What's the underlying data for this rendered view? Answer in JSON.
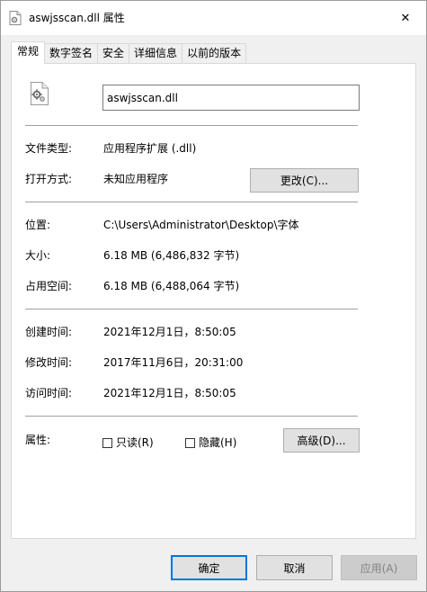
{
  "window": {
    "title": "aswjsscan.dll 属性",
    "close_glyph": "✕"
  },
  "tabs": [
    {
      "label": "常规",
      "active": true
    },
    {
      "label": "数字签名",
      "active": false
    },
    {
      "label": "安全",
      "active": false
    },
    {
      "label": "详细信息",
      "active": false
    },
    {
      "label": "以前的版本",
      "active": false
    }
  ],
  "general": {
    "filename": "aswjsscan.dll",
    "file_type_label": "文件类型:",
    "file_type_value": "应用程序扩展 (.dll)",
    "open_with_label": "打开方式:",
    "open_with_value": "未知应用程序",
    "change_button": "更改(C)...",
    "location_label": "位置:",
    "location_value": "C:\\Users\\Administrator\\Desktop\\字体",
    "size_label": "大小:",
    "size_value": "6.18 MB (6,486,832 字节)",
    "size_on_disk_label": "占用空间:",
    "size_on_disk_value": "6.18 MB (6,488,064 字节)",
    "created_label": "创建时间:",
    "created_value": "2021年12月1日，8:50:05",
    "modified_label": "修改时间:",
    "modified_value": "2017年11月6日，20:31:00",
    "accessed_label": "访问时间:",
    "accessed_value": "2021年12月1日，8:50:05",
    "attributes_label": "属性:",
    "readonly_label": "只读(R)",
    "hidden_label": "隐藏(H)",
    "advanced_button": "高级(D)..."
  },
  "footer": {
    "ok": "确定",
    "cancel": "取消",
    "apply": "应用(A)"
  },
  "colors": {
    "accent": "#0078d7",
    "disabled_text": "#838383"
  }
}
